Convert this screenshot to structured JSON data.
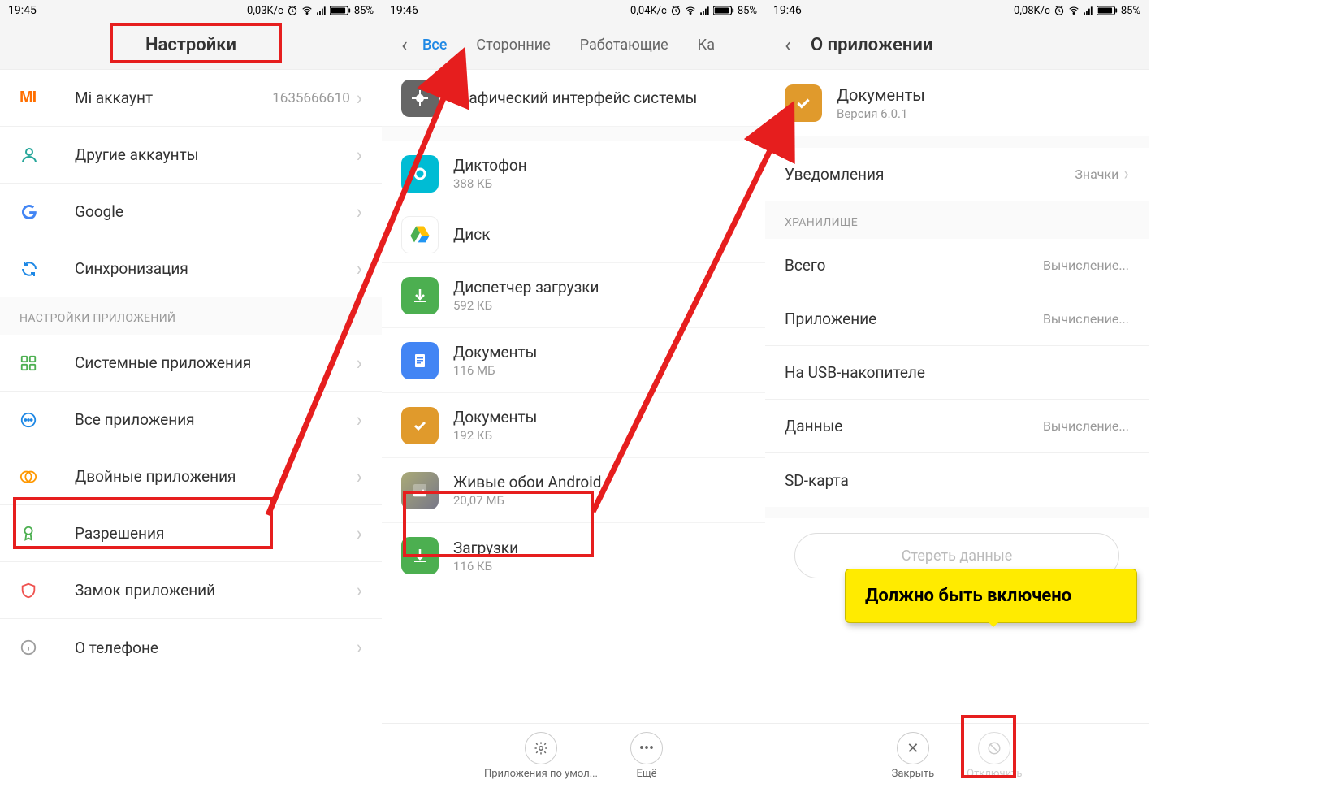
{
  "screen1": {
    "status": {
      "time": "19:45",
      "speed": "0,03K/c",
      "battery": "85%"
    },
    "title": "Настройки",
    "rows_accounts": [
      {
        "key": "mi",
        "label": "Mi аккаунт",
        "value": "1635666610"
      },
      {
        "key": "other",
        "label": "Другие аккаунты",
        "value": ""
      },
      {
        "key": "google",
        "label": "Google",
        "value": ""
      },
      {
        "key": "sync",
        "label": "Синхронизация",
        "value": ""
      }
    ],
    "section_apps_header": "НАСТРОЙКИ ПРИЛОЖЕНИЙ",
    "rows_apps": [
      {
        "key": "system",
        "label": "Системные приложения"
      },
      {
        "key": "all",
        "label": "Все приложения"
      },
      {
        "key": "dual",
        "label": "Двойные приложения"
      },
      {
        "key": "perms",
        "label": "Разрешения"
      },
      {
        "key": "lock",
        "label": "Замок приложений"
      },
      {
        "key": "about",
        "label": "О телефоне"
      }
    ]
  },
  "screen2": {
    "status": {
      "time": "19:46",
      "speed": "0,04K/c",
      "battery": "85%"
    },
    "tabs": [
      "Все",
      "Сторонние",
      "Работающие",
      "Ка"
    ],
    "active_tab": 0,
    "apps": [
      {
        "name": "Графический интерфейс системы",
        "sub": "",
        "bg": "#666666",
        "glyph": "sys"
      },
      {
        "name": "Диктофон",
        "sub": "388 КБ",
        "bg": "#00BCD4",
        "glyph": "rec"
      },
      {
        "name": "Диск",
        "sub": "",
        "bg": "#ffffff",
        "glyph": "drive"
      },
      {
        "name": "Диспетчер загрузки",
        "sub": "592 КБ",
        "bg": "#4CAF50",
        "glyph": "down"
      },
      {
        "name": "Документы",
        "sub": "116 МБ",
        "bg": "#4285F4",
        "glyph": "docs"
      },
      {
        "name": "Документы",
        "sub": "192 КБ",
        "bg": "#E09A2C",
        "glyph": "check"
      },
      {
        "name": "Живые обои Android",
        "sub": "20,07 МБ",
        "bg": "#888888",
        "glyph": "wall"
      },
      {
        "name": "Загрузки",
        "sub": "116 КБ",
        "bg": "#4CAF50",
        "glyph": "down"
      }
    ],
    "bottom": {
      "default_label": "Приложения по умол...",
      "more_label": "Ещё"
    }
  },
  "screen3": {
    "status": {
      "time": "19:46",
      "speed": "0,08K/c",
      "battery": "85%"
    },
    "title": "О приложении",
    "app": {
      "name": "Документы",
      "version": "Версия 6.0.1",
      "bg": "#E09A2C"
    },
    "notifications": {
      "label": "Уведомления",
      "value": "Значки"
    },
    "storage_header": "ХРАНИЛИЩЕ",
    "rows": [
      {
        "label": "Всего",
        "value": "Вычисление..."
      },
      {
        "label": "Приложение",
        "value": "Вычисление..."
      },
      {
        "label": "На USB-накопителе",
        "value": ""
      },
      {
        "label": "Данные",
        "value": "Вычисление..."
      },
      {
        "label": "SD-карта",
        "value": ""
      }
    ],
    "clear_data": "Стереть данные",
    "bottom": {
      "close": "Закрыть",
      "disable": "Отключить"
    }
  },
  "annotations": {
    "tooltip_text": "Должно быть включено"
  }
}
